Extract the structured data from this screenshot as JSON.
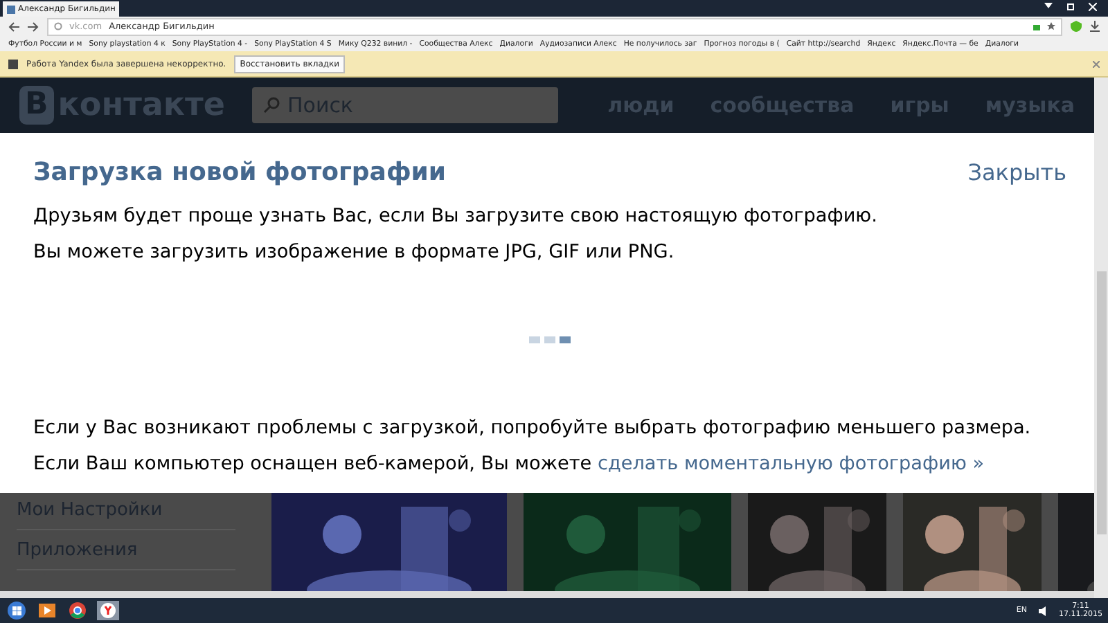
{
  "browser": {
    "tab_title": "Александр Бигильдин",
    "address": {
      "domain": "vk.com",
      "page_title": "Александр Бигильдин"
    },
    "bookmarks": [
      "Футбол России и м",
      "Sony playstation 4 к",
      "Sony PlayStation 4 -",
      "Sony PlayStation 4 S",
      "Микy Q232 винил -",
      "Сообщества Алекс",
      "Диалоги",
      "Аудиозаписи Алекс",
      "Не получилось заг",
      "Прогноз погоды в (",
      "Сайт http://searchd",
      "Яндекс",
      "Яндекс.Почта — бе",
      "Диалоги"
    ],
    "notification": {
      "message": "Работа Yandex была завершена некорректно.",
      "button": "Восстановить вкладки"
    }
  },
  "vk_header": {
    "logo_badge": "В",
    "logo_text": "контакте",
    "search_placeholder": "Поиск",
    "nav": [
      "люди",
      "сообщества",
      "игры",
      "музыка"
    ]
  },
  "modal": {
    "title": "Загрузка новой фотографии",
    "close": "Закрыть",
    "paragraphs": [
      "Друзьям будет проще узнать Вас, если Вы загрузите свою настоящую фотографию.",
      "Вы можете загрузить изображение в формате JPG, GIF или PNG."
    ],
    "loader": [
      {
        "selected": false
      },
      {
        "selected": false
      },
      {
        "selected": true
      }
    ],
    "hint": "Если у Вас возникают проблемы с загрузкой, попробуйте выбрать фотографию меньшего размера.",
    "webcam": {
      "text": "Если Ваш компьютер оснащен веб-камерой, Вы можете",
      "link": "сделать моментальную фотографию »"
    }
  },
  "background": {
    "menu": [
      "Мои Настройки",
      "Приложения"
    ],
    "photos": [
      {
        "kind": "picture"
      },
      {
        "kind": "picture"
      },
      {
        "kind": "picture"
      },
      {
        "kind": "picture"
      },
      {
        "kind": "picture"
      }
    ]
  },
  "taskbar": {
    "language": "EN",
    "time": "7:11",
    "date": "17.11.2015"
  }
}
